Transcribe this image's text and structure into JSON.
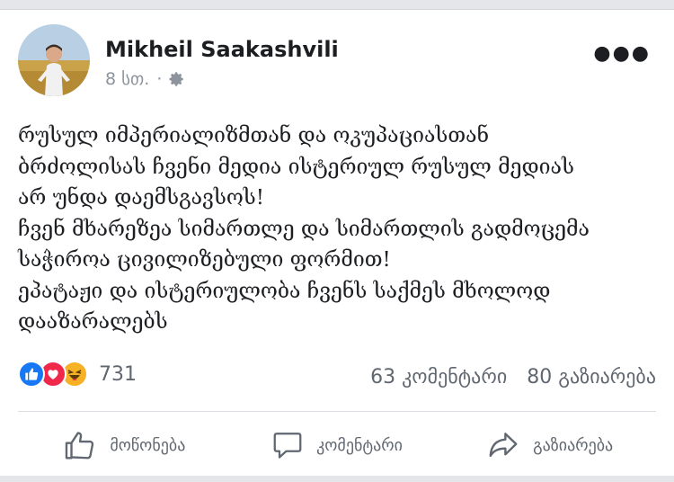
{
  "post": {
    "author": "Mikheil Saakashvili",
    "time": "8 სთ.",
    "privacy_icon": "gear-icon",
    "more_icon": "more-options-icon",
    "lines": [
      "რუსულ იმპერიალიზმთან და ოკუპაციასთან",
      "ბრძოლისას ჩვენი მედია ისტერიულ რუსულ მედიას",
      "არ უნდა დაემსგავსოს!",
      "ჩვენ მხარეზეა სიმართლე და სიმართლის გადმოცემა",
      "საჭიროა ცივილიზებული ფორმით!",
      "ეპატაჟი და ისტერიულობა ჩვენს საქმეს მხოლოდ",
      "დააზარალებს"
    ]
  },
  "engagement": {
    "reactions": [
      "like",
      "love",
      "haha"
    ],
    "reaction_count": "731",
    "comments": "63 კომენტარი",
    "shares": "80 გაზიარება"
  },
  "actions": {
    "like_label": "მოწონება",
    "comment_label": "კომენტარი",
    "share_label": "გაზიარება"
  },
  "colors": {
    "like": "#1877f2",
    "love": "#f0284a",
    "haha": "#f7b125",
    "secondary_text": "#606770"
  }
}
